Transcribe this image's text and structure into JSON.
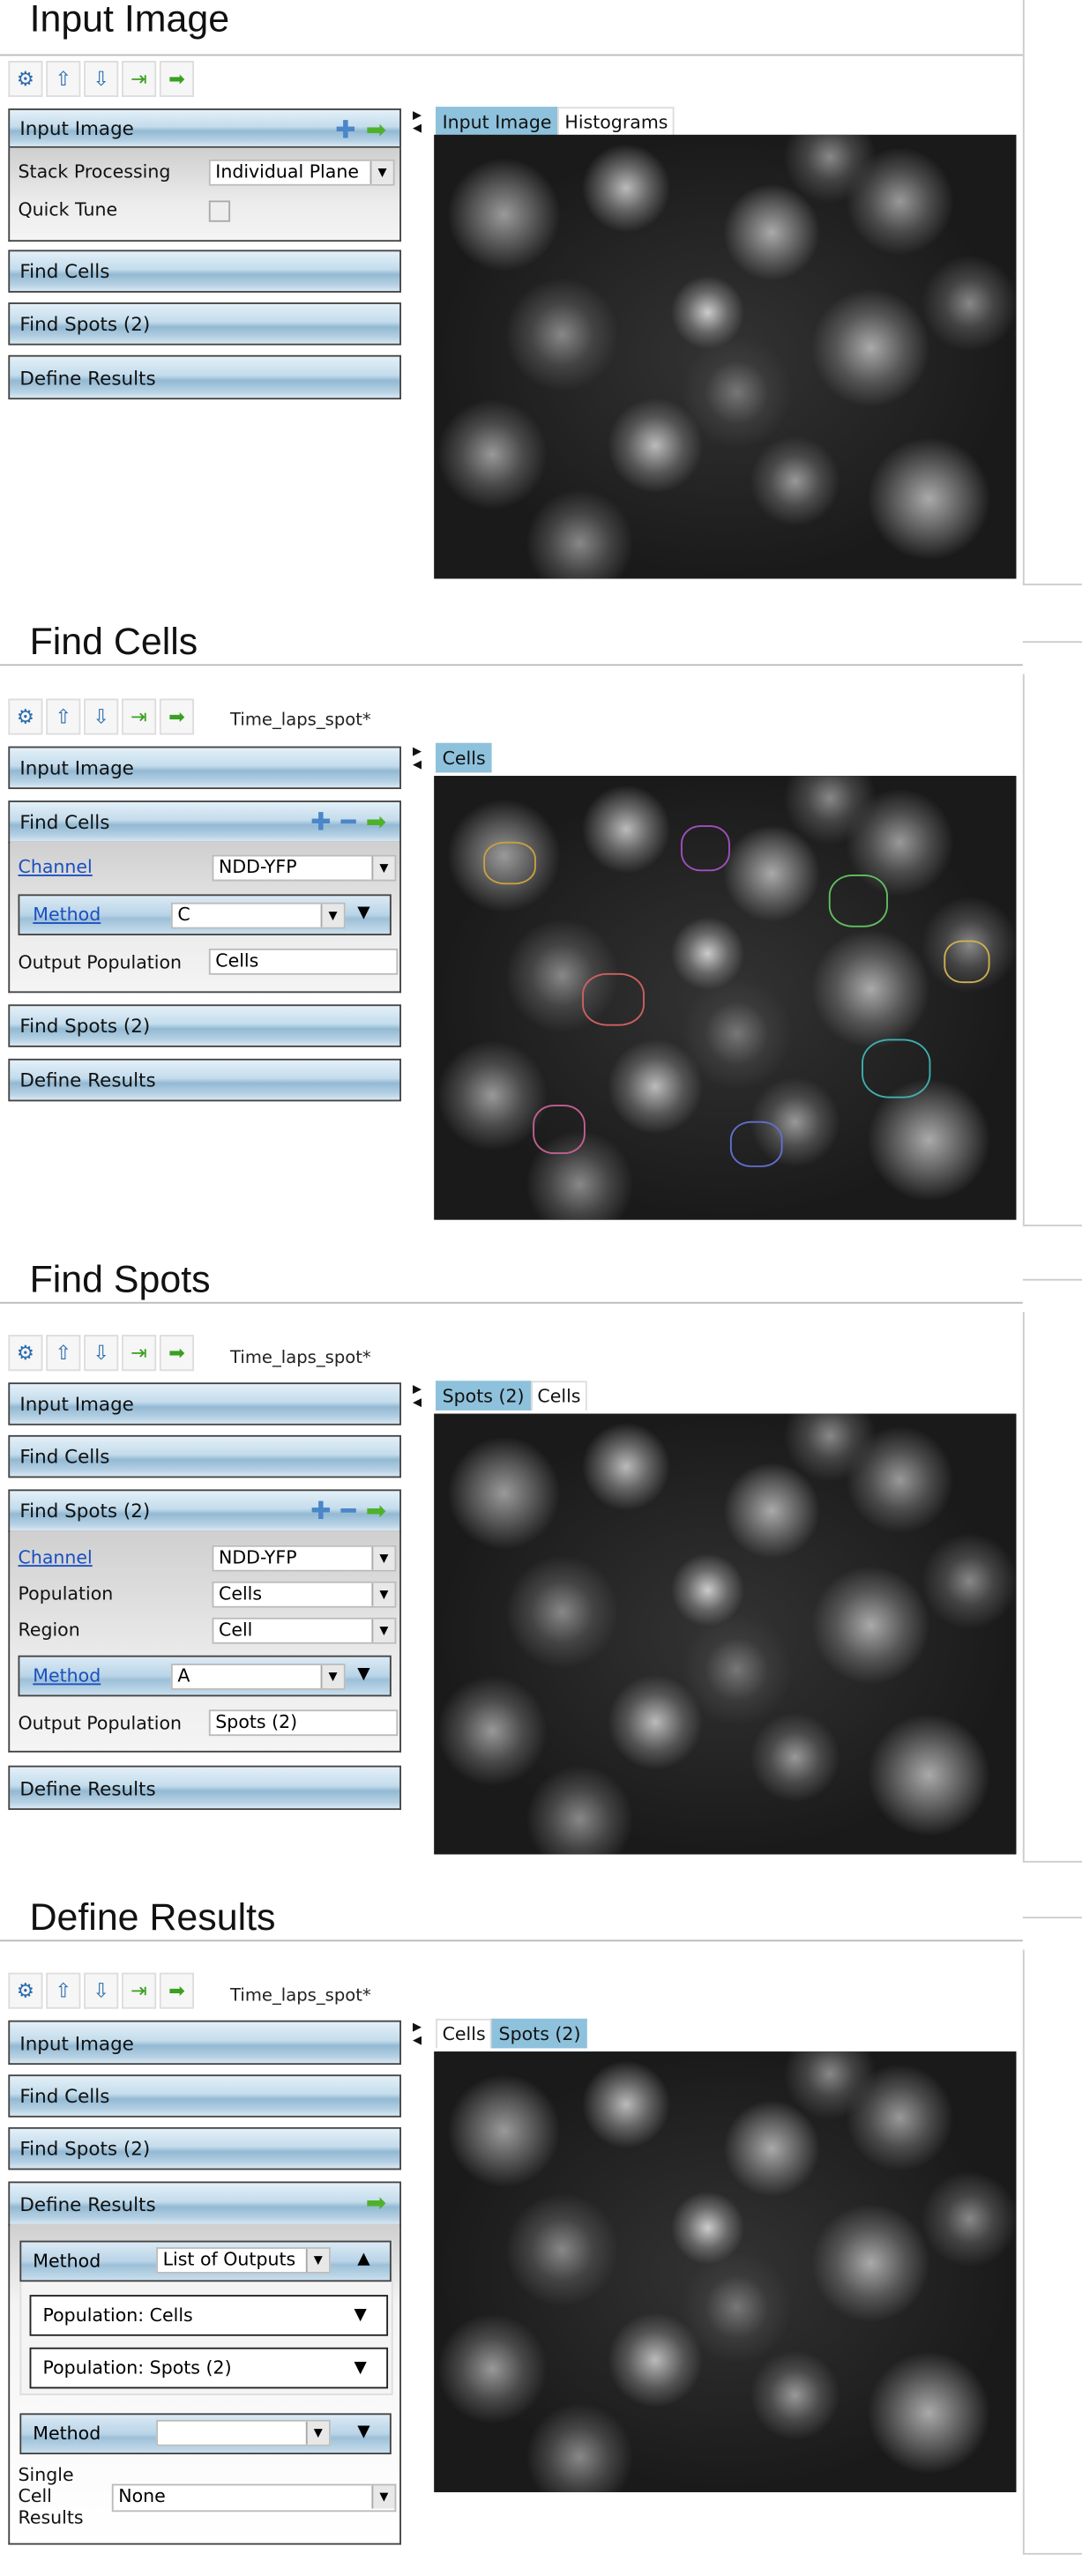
{
  "sections": [
    {
      "title": "Input Image",
      "panels": {
        "input_image": "Input Image",
        "stack_processing_label": "Stack Processing",
        "stack_processing_value": "Individual Plane",
        "quick_tune_label": "Quick Tune",
        "quick_tune_checked": false,
        "find_cells": "Find Cells",
        "find_spots": "Find Spots (2)",
        "define_results": "Define Results"
      },
      "tabs": [
        "Input Image",
        "Histograms"
      ],
      "active_tab": "Input Image"
    },
    {
      "title": "Find Cells",
      "document": "Time_laps_spot*",
      "panels": {
        "input_image": "Input Image",
        "find_cells": "Find Cells",
        "channel_label": "Channel",
        "channel_value": "NDD-YFP",
        "method_label": "Method",
        "method_value": "C",
        "output_label": "Output Population",
        "output_value": "Cells",
        "find_spots": "Find Spots (2)",
        "define_results": "Define Results"
      },
      "tabs": [
        "Cells"
      ],
      "active_tab": "Cells"
    },
    {
      "title": "Find Spots",
      "document": "Time_laps_spot*",
      "panels": {
        "input_image": "Input Image",
        "find_cells": "Find Cells",
        "find_spots": "Find Spots (2)",
        "channel_label": "Channel",
        "channel_value": "NDD-YFP",
        "population_label": "Population",
        "population_value": "Cells",
        "region_label": "Region",
        "region_value": "Cell",
        "method_label": "Method",
        "method_value": "A",
        "output_label": "Output Population",
        "output_value": "Spots (2)",
        "define_results": "Define Results"
      },
      "tabs": [
        "Spots (2)",
        "Cells"
      ],
      "active_tab": "Spots (2)"
    },
    {
      "title": "Define Results",
      "document": "Time_laps_spot*",
      "panels": {
        "input_image": "Input Image",
        "find_cells": "Find Cells",
        "find_spots": "Find Spots (2)",
        "define_results": "Define Results",
        "method_label": "Method",
        "method_value": "List of Outputs",
        "population_cells": "Population: Cells",
        "population_spots": "Population: Spots (2)",
        "method2_label": "Method",
        "method2_value": "",
        "single_cell_label": "Single Cell Results",
        "single_cell_value": "None"
      },
      "tabs": [
        "Cells",
        "Spots (2)"
      ],
      "active_tab": "Spots (2)"
    }
  ],
  "icons": {
    "toolbar": [
      "workflow-icon",
      "load-icon",
      "save-icon",
      "export-icon",
      "run-icon"
    ],
    "add": "plus-icon",
    "remove": "minus-icon",
    "run": "green-arrow-icon"
  },
  "colors": {
    "header_blue": "#93b9d3",
    "active_tab": "#8ec1dc",
    "run_green": "#4fb12a",
    "link": "#1a4fc0"
  }
}
